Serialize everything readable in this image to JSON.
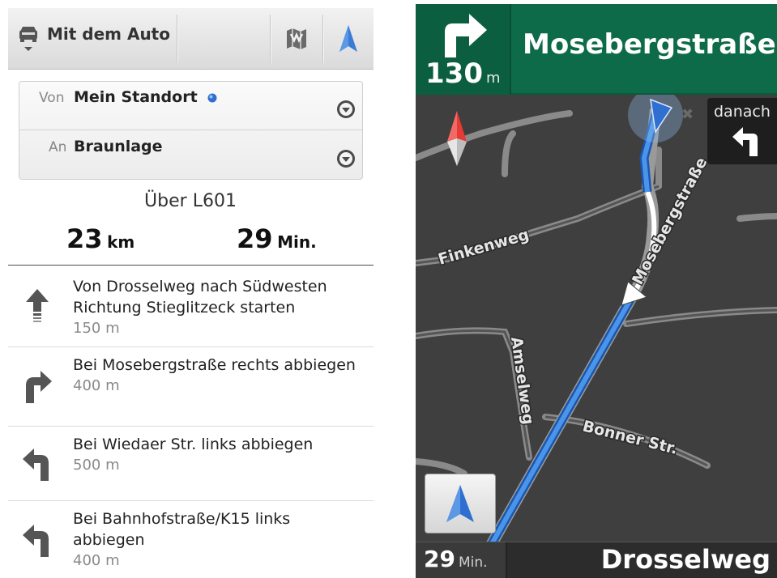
{
  "toolbar": {
    "mode_label": "Mit dem Auto",
    "icons": [
      "car-icon",
      "map-icon",
      "navigation-arrow-icon"
    ],
    "accent": "#3a7bd5"
  },
  "route": {
    "from_prefix": "Von",
    "from_value": "Mein Standort",
    "to_prefix": "An",
    "to_value": "Braunlage"
  },
  "summary": {
    "via": "Über L601",
    "distance_value": "23",
    "distance_unit": "km",
    "duration_value": "29",
    "duration_unit": "Min."
  },
  "steps": [
    {
      "instruction": "Von Drosselweg nach Südwesten Richtung Stieglitzeck starten",
      "distance": "150 m",
      "icon": "straight-arrow-icon"
    },
    {
      "instruction": "Bei Mosebergstraße rechts abbiegen",
      "distance": "400 m",
      "icon": "turn-right-icon"
    },
    {
      "instruction": "Bei Wiedaer Str. links abbiegen",
      "distance": "500 m",
      "icon": "turn-left-icon"
    },
    {
      "instruction": "Bei Bahnhofstraße/K15 links abbiegen",
      "distance": "400 m",
      "icon": "turn-left-icon"
    }
  ],
  "navigation": {
    "next_turn_distance": "130",
    "next_turn_unit": "m",
    "next_street": "Mosebergstraße",
    "then_label": "danach",
    "eta_value": "29",
    "eta_unit": "Min.",
    "current_street": "Drosselweg",
    "header_color": "#0d6b4a",
    "route_color": "#3a86e0"
  },
  "map_labels": {
    "finkenweg": "Finkenweg",
    "mosebergstrasse": "Mosebergstraße",
    "amselweg": "Amselweg",
    "bonner": "Bonner Str."
  }
}
